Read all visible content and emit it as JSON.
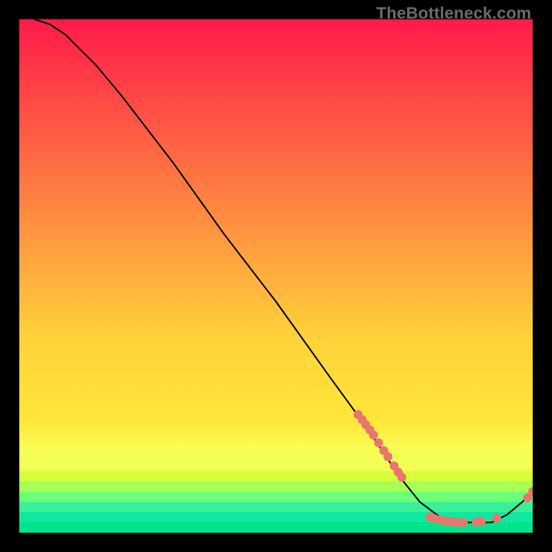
{
  "watermark": "TheBottleneck.com",
  "colors": {
    "black": "#000000",
    "line": "#000000",
    "dot": "#e9766c",
    "grad_top": "#ff1a4a",
    "grad_mid1": "#ff7a3a",
    "grad_mid2": "#ffd23a",
    "grad_yellow": "#ffe63a",
    "grad_yellowgreen": "#d6ff3a",
    "grad_green1": "#6bff7a",
    "grad_green2": "#00e58a"
  },
  "chart_data": {
    "type": "line",
    "title": "",
    "xlabel": "",
    "ylabel": "",
    "xlim": [
      0,
      100
    ],
    "ylim": [
      0,
      100
    ],
    "gradient_bands": [
      {
        "from": 0,
        "to": 62,
        "color_top": "#ff1a4a",
        "color_bottom": "#ffd23a",
        "smooth": true
      },
      {
        "from": 62,
        "to": 78,
        "color_top": "#ffd23a",
        "color_bottom": "#ffe63a",
        "smooth": true
      },
      {
        "from": 78,
        "to": 84,
        "color_top": "#ffe63a",
        "color_bottom": "#faff55",
        "smooth": true
      },
      {
        "from": 84,
        "to": 88,
        "color": "#f3ff55"
      },
      {
        "from": 88,
        "to": 90,
        "color": "#d6ff3a"
      },
      {
        "from": 90,
        "to": 92,
        "color": "#a8ff55"
      },
      {
        "from": 92,
        "to": 94,
        "color": "#6bff7a"
      },
      {
        "from": 94,
        "to": 96,
        "color": "#38f09a"
      },
      {
        "from": 96,
        "to": 98,
        "color": "#10e8a0"
      },
      {
        "from": 98,
        "to": 100,
        "color": "#00e58a"
      }
    ],
    "curve_points": [
      {
        "x": 3,
        "y": 100
      },
      {
        "x": 6,
        "y": 99
      },
      {
        "x": 9,
        "y": 97
      },
      {
        "x": 12,
        "y": 94
      },
      {
        "x": 15,
        "y": 91
      },
      {
        "x": 20,
        "y": 85
      },
      {
        "x": 30,
        "y": 72
      },
      {
        "x": 40,
        "y": 58
      },
      {
        "x": 50,
        "y": 45
      },
      {
        "x": 60,
        "y": 31
      },
      {
        "x": 68,
        "y": 20
      },
      {
        "x": 74,
        "y": 11
      },
      {
        "x": 78,
        "y": 6
      },
      {
        "x": 82,
        "y": 3
      },
      {
        "x": 86,
        "y": 2
      },
      {
        "x": 92,
        "y": 2
      },
      {
        "x": 95,
        "y": 3.5
      },
      {
        "x": 98,
        "y": 6
      },
      {
        "x": 100,
        "y": 8
      }
    ],
    "dot_clusters": [
      {
        "x": 66.0,
        "y": 23.0
      },
      {
        "x": 66.8,
        "y": 22.0
      },
      {
        "x": 67.5,
        "y": 21.0
      },
      {
        "x": 68.3,
        "y": 20.0
      },
      {
        "x": 69.0,
        "y": 19.0
      },
      {
        "x": 70.0,
        "y": 17.5
      },
      {
        "x": 71.0,
        "y": 16.0
      },
      {
        "x": 71.8,
        "y": 14.8
      },
      {
        "x": 73.0,
        "y": 13.0
      },
      {
        "x": 73.8,
        "y": 11.8
      },
      {
        "x": 74.5,
        "y": 10.8
      },
      {
        "x": 80.0,
        "y": 3.0
      },
      {
        "x": 81.0,
        "y": 2.7
      },
      {
        "x": 82.0,
        "y": 2.5
      },
      {
        "x": 82.8,
        "y": 2.3
      },
      {
        "x": 83.6,
        "y": 2.2
      },
      {
        "x": 84.5,
        "y": 2.1
      },
      {
        "x": 85.5,
        "y": 2.0
      },
      {
        "x": 86.5,
        "y": 2.0
      },
      {
        "x": 89.0,
        "y": 2.1
      },
      {
        "x": 90.0,
        "y": 2.2
      },
      {
        "x": 93.0,
        "y": 2.8
      },
      {
        "x": 99.0,
        "y": 6.8
      },
      {
        "x": 100.0,
        "y": 8.0
      }
    ]
  }
}
